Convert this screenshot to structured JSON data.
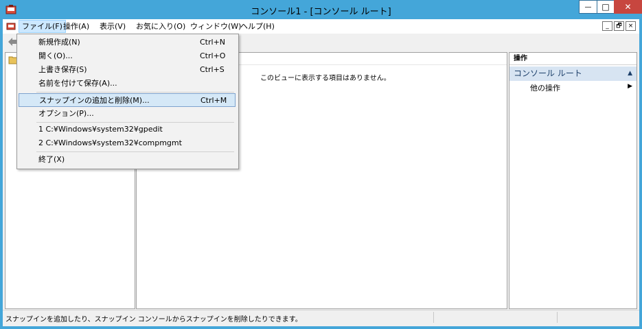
{
  "window": {
    "title": "コンソール1 - [コンソール ルート]",
    "min_glyph": "—",
    "max_glyph": "□",
    "close_glyph": "✕"
  },
  "menubar": {
    "items": [
      "ファイル(F)",
      "操作(A)",
      "表示(V)",
      "お気に入り(O)",
      "ウィンドウ(W)",
      "ヘルプ(H)"
    ],
    "active": "ファイル(F)",
    "mdi_min": "_",
    "mdi_restore": "🗗",
    "mdi_close": "×"
  },
  "file_menu": {
    "items": [
      {
        "label": "新規作成(N)",
        "shortcut": "Ctrl+N"
      },
      {
        "label": "開く(O)...",
        "shortcut": "Ctrl+O"
      },
      {
        "label": "上書き保存(S)",
        "shortcut": "Ctrl+S"
      },
      {
        "label": "名前を付けて保存(A)...",
        "shortcut": ""
      },
      {
        "label": "スナップインの追加と削除(M)...",
        "shortcut": "Ctrl+M"
      },
      {
        "label": "オプション(P)...",
        "shortcut": ""
      },
      {
        "label": "1 C:¥Windows¥system32¥gpedit",
        "shortcut": ""
      },
      {
        "label": "2 C:¥Windows¥system32¥compmgmt",
        "shortcut": ""
      },
      {
        "label": "終了(X)",
        "shortcut": ""
      }
    ],
    "highlighted": "スナップインの追加と削除(M)..."
  },
  "middle_pane": {
    "empty_message": "このビューに表示する項目はありません。"
  },
  "actions_pane": {
    "title": "操作",
    "section": "コンソール ルート",
    "items": [
      "他の操作"
    ]
  },
  "statusbar": {
    "text": "スナップインを追加したり、スナップイン コンソールからスナップインを削除したりできます。"
  },
  "colors": {
    "frame": "#44a6d9",
    "close_button": "#c7463f",
    "highlight": "#d5e8f7"
  }
}
